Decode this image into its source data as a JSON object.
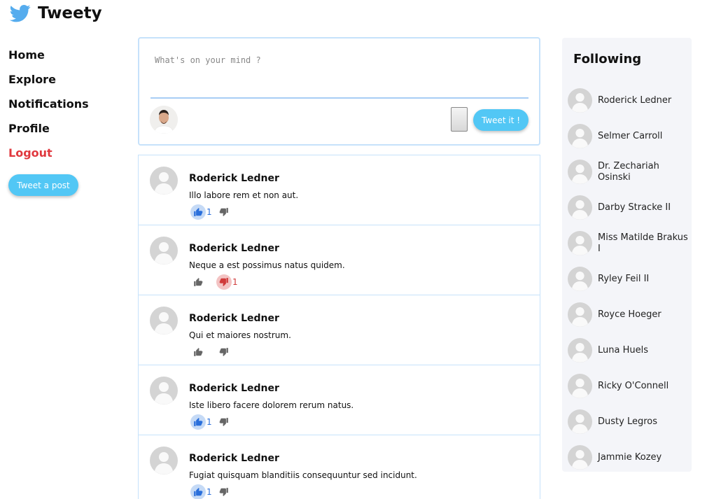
{
  "app": {
    "name": "Tweety"
  },
  "nav": {
    "items": [
      "Home",
      "Explore",
      "Notifications",
      "Profile"
    ],
    "logout": "Logout",
    "tweet_button": "Tweet a post"
  },
  "composer": {
    "placeholder": "What's on your mind ?",
    "submit_label": "Tweet it !"
  },
  "tweets": [
    {
      "author": "Roderick Ledner",
      "text": "Illo labore rem et non aut.",
      "likes": "1",
      "dislikes": "",
      "liked": true,
      "disliked": false
    },
    {
      "author": "Roderick Ledner",
      "text": "Neque a est possimus natus quidem.",
      "likes": "",
      "dislikes": "1",
      "liked": false,
      "disliked": true
    },
    {
      "author": "Roderick Ledner",
      "text": "Qui et maiores nostrum.",
      "likes": "",
      "dislikes": "",
      "liked": false,
      "disliked": false
    },
    {
      "author": "Roderick Ledner",
      "text": "Iste libero facere dolorem rerum natus.",
      "likes": "1",
      "dislikes": "",
      "liked": true,
      "disliked": false
    },
    {
      "author": "Roderick Ledner",
      "text": "Fugiat quisquam blanditiis consequuntur sed incidunt.",
      "likes": "1",
      "dislikes": "",
      "liked": true,
      "disliked": false
    }
  ],
  "following": {
    "title": "Following",
    "users": [
      "Roderick Ledner",
      "Selmer Carroll",
      "Dr. Zechariah Osinski",
      "Darby Stracke II",
      "Miss Matilde Brakus I",
      "Ryley Feil II",
      "Royce Hoeger",
      "Luna Huels",
      "Ricky O'Connell",
      "Dusty Legros",
      "Jammie Kozey"
    ]
  },
  "colors": {
    "accent": "#52c7f5",
    "logout": "#e0383e",
    "like": "#2a6fdb",
    "dislike": "#d03a3a"
  }
}
